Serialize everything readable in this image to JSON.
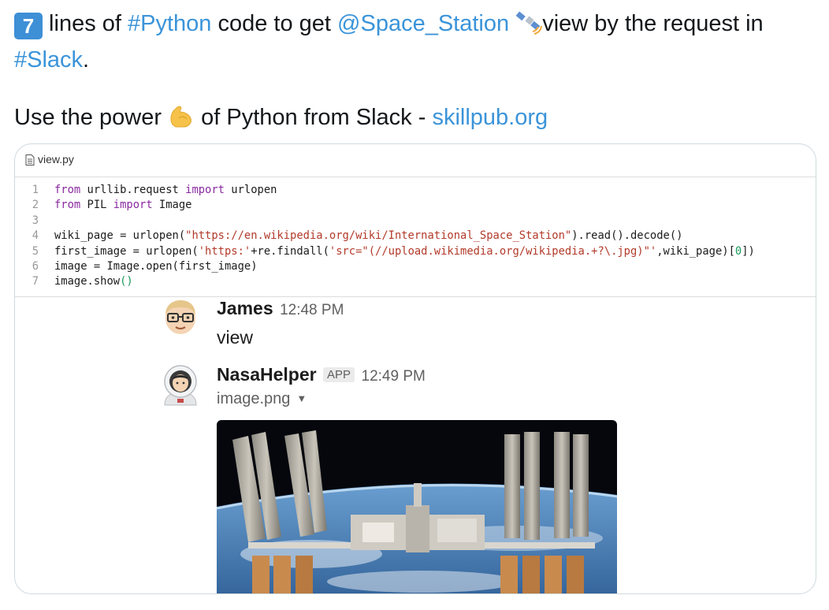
{
  "tweet": {
    "line1": {
      "keycap": "7",
      "t1": " lines of ",
      "hashtag_python": "#Python",
      "t2": " code to get ",
      "mention": "@Space_Station",
      "t3": "view by the request in"
    },
    "line2": {
      "hashtag_slack": "#Slack",
      "t4": "."
    },
    "line3": {
      "t5": "Use the power ",
      "t6": " of Python from Slack - ",
      "link": "skillpub.org"
    }
  },
  "code_card": {
    "filename": "view.py",
    "lines": [
      {
        "n": "1",
        "parts": [
          [
            "kw",
            "from"
          ],
          [
            "src",
            " urllib.request "
          ],
          [
            "kw",
            "import"
          ],
          [
            "src",
            " urlopen"
          ]
        ]
      },
      {
        "n": "2",
        "parts": [
          [
            "kw",
            "from"
          ],
          [
            "src",
            " PIL "
          ],
          [
            "kw",
            "import"
          ],
          [
            "src",
            " Image"
          ]
        ]
      },
      {
        "n": "3",
        "parts": []
      },
      {
        "n": "4",
        "parts": [
          [
            "src",
            "wiki_page = urlopen("
          ],
          [
            "str",
            "\"https://en.wikipedia.org/wiki/International_Space_Station\""
          ],
          [
            "src",
            ").read().decode()"
          ]
        ]
      },
      {
        "n": "5",
        "parts": [
          [
            "src",
            "first_image = urlopen("
          ],
          [
            "str",
            "'https:'"
          ],
          [
            "src",
            "+re.findall("
          ],
          [
            "str",
            "'src=\"(//upload.wikimedia.org/wikipedia.+?\\.jpg)\"'"
          ],
          [
            "src",
            ",wiki_page)["
          ],
          [
            "num",
            "0"
          ],
          [
            "src",
            "])"
          ]
        ]
      },
      {
        "n": "6",
        "parts": [
          [
            "src",
            "image = Image.open(first_image)"
          ]
        ]
      },
      {
        "n": "7",
        "parts": [
          [
            "src",
            "image.show"
          ],
          [
            "num",
            "()"
          ]
        ]
      }
    ]
  },
  "messages": {
    "james": {
      "name": "James",
      "time": "12:48 PM",
      "text": "view"
    },
    "nasa": {
      "name": "NasaHelper",
      "badge": "APP",
      "time": "12:49 PM",
      "file": "image.png"
    }
  }
}
